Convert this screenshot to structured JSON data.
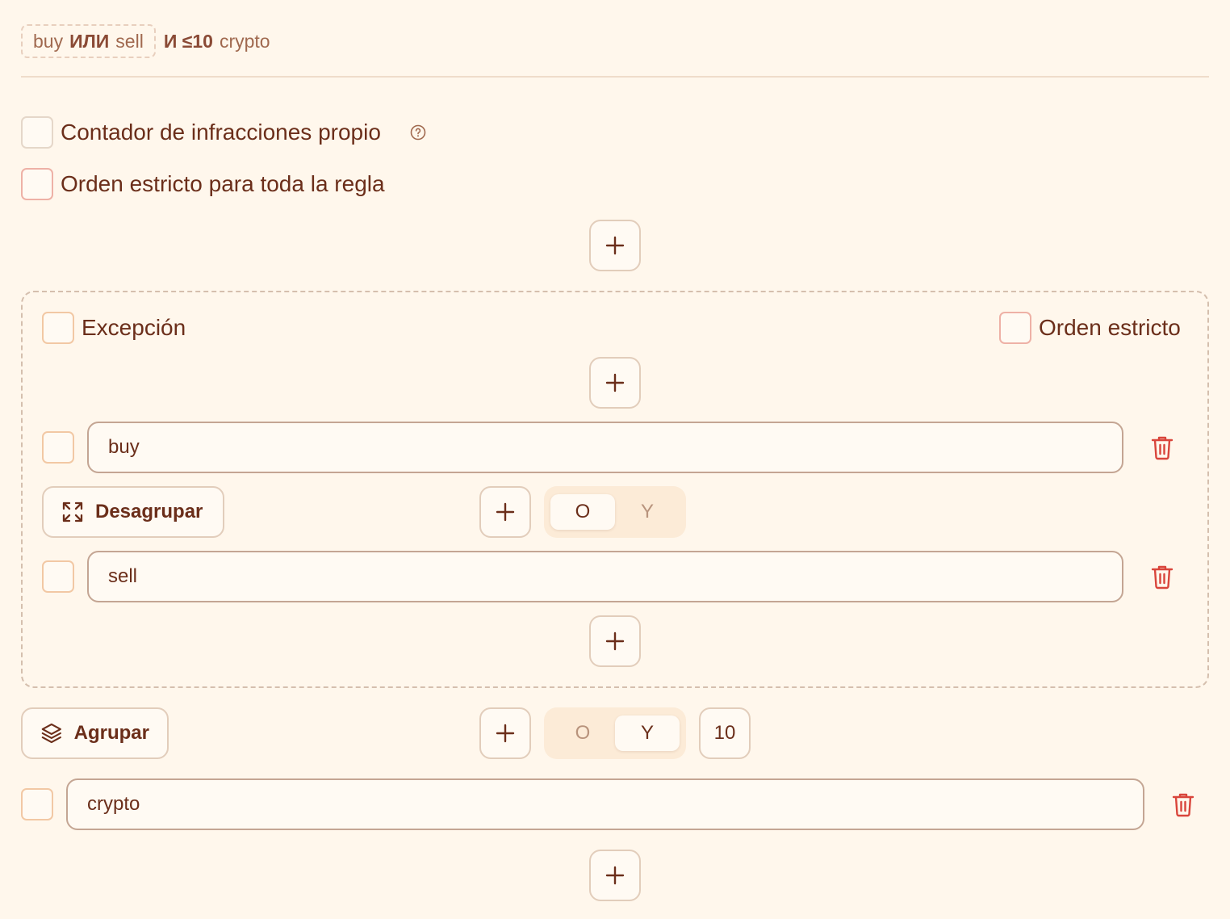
{
  "summary": {
    "group_term_1": "buy",
    "group_op": "ИЛИ",
    "group_term_2": "sell",
    "outer_op": "И ≤10",
    "outer_term": "crypto"
  },
  "options": {
    "own_counter_label": "Contador de infracciones propio",
    "strict_order_rule_label": "Orden estricto para toda la regla"
  },
  "group": {
    "exception_label": "Excepción",
    "strict_order_label": "Orden estricto",
    "terms": [
      {
        "value": "buy"
      },
      {
        "value": "sell"
      }
    ],
    "ungroup_label": "Desagrupar",
    "toggle": {
      "o_label": "O",
      "y_label": "Y",
      "selected": "O"
    }
  },
  "outer": {
    "group_label": "Agrupar",
    "toggle": {
      "o_label": "O",
      "y_label": "Y",
      "selected": "Y"
    },
    "distance_value": "10",
    "terms": [
      {
        "value": "crypto"
      }
    ]
  },
  "colors": {
    "background": "#fff7ec",
    "text": "#6b2e1a",
    "delete": "#d9453b"
  }
}
